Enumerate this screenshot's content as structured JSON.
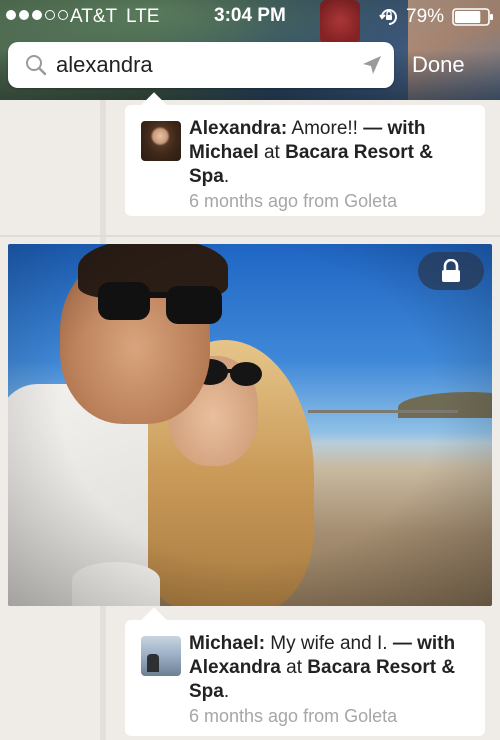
{
  "status_bar": {
    "signal_dots_on": 3,
    "signal_dots_total": 5,
    "carrier": "AT&T",
    "network": "LTE",
    "time": "3:04 PM",
    "orientation_lock_icon": "orientation-lock-icon",
    "battery_percent": "79%",
    "battery_level": 0.79
  },
  "search": {
    "query": "alexandra",
    "search_icon": "search-icon",
    "location_icon": "location-arrow-icon",
    "done_label": "Done"
  },
  "feed": [
    {
      "author": "Alexandra:",
      "message": " Amore!! ",
      "dash": "— with",
      "with": "Michael",
      "at_word": " at ",
      "place": "Bacara Resort & Spa",
      "period": ".",
      "meta": "6 months ago from Goleta"
    },
    {
      "author": "Michael:",
      "message": " My wife and I. ",
      "dash": "— with",
      "with": "Alexandra",
      "at_word": " at ",
      "place": "Bacara Resort & Spa",
      "period": ".",
      "meta": "6 months ago from Goleta"
    }
  ],
  "photo": {
    "privacy_icon": "lock-icon"
  },
  "colors": {
    "background": "#efebe6",
    "card": "#ffffff",
    "meta_text": "#a6a6a6",
    "badge": "#28374f"
  }
}
